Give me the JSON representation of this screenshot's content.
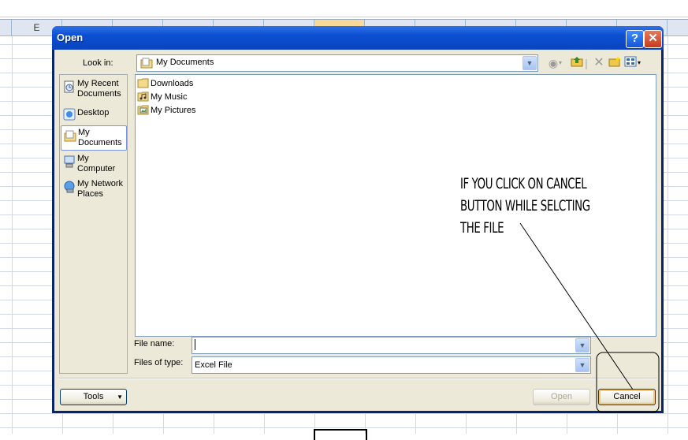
{
  "excel": {
    "column_label": "E"
  },
  "dialog": {
    "title": "Open",
    "help_symbol": "?",
    "close_symbol": "✕",
    "look_in_label": "Look in:",
    "look_in_value": "My Documents",
    "places": [
      {
        "label": "My Recent Documents",
        "icon": "recent-documents-icon"
      },
      {
        "label": "Desktop",
        "icon": "desktop-icon"
      },
      {
        "label": "My Documents",
        "icon": "my-documents-icon",
        "selected": true
      },
      {
        "label": "My Computer",
        "icon": "my-computer-icon"
      },
      {
        "label": "My Network Places",
        "icon": "network-places-icon"
      }
    ],
    "files": [
      {
        "name": "Downloads",
        "icon": "folder-icon"
      },
      {
        "name": "My Music",
        "icon": "music-folder-icon"
      },
      {
        "name": "My Pictures",
        "icon": "pictures-folder-icon"
      }
    ],
    "file_name_label": "File name:",
    "file_name_value": "",
    "files_of_type_label": "Files of type:",
    "files_of_type_value": "Excel File",
    "tools_label": "Tools",
    "open_label": "Open",
    "cancel_label": "Cancel"
  },
  "annotation": {
    "lines": [
      "IF YOU CLICK ON CANCEL",
      "BUTTON WHILE SELCTING",
      "THE FILE"
    ]
  },
  "colors": {
    "titlebar": "#0b4fd1",
    "dialog_bg": "#ece9d8",
    "default_button_glow": "#f5c86b"
  }
}
